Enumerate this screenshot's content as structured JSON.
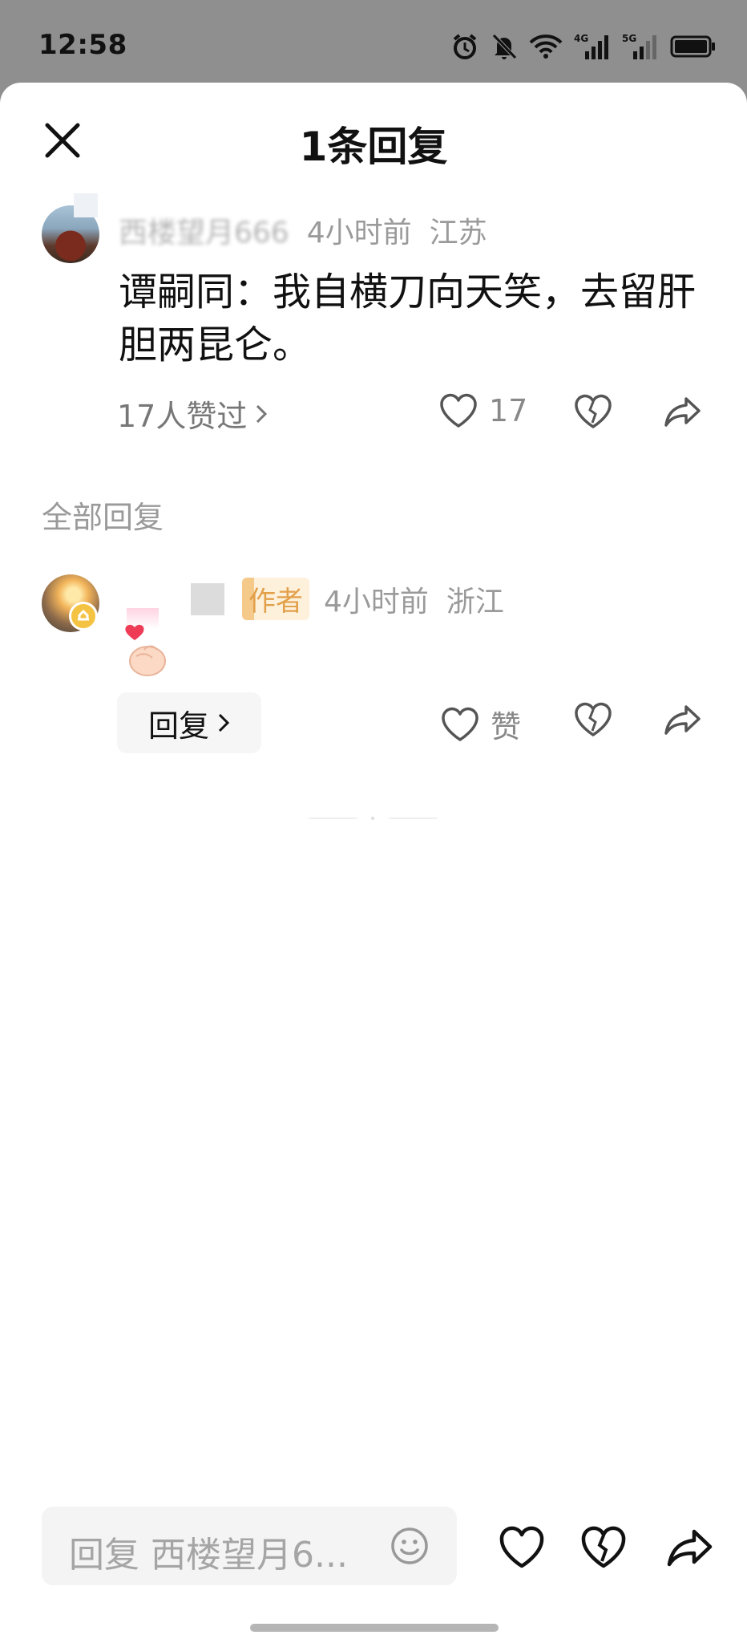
{
  "status_bar": {
    "time": "12:58",
    "icons": [
      "alarm-icon",
      "bell-muted-icon",
      "wifi-icon",
      "signal-4g-icon",
      "signal-5g-icon",
      "battery-icon"
    ],
    "net1": "4G",
    "net2": "5G"
  },
  "sheet": {
    "title": "1条回复",
    "close_icon": "close-icon"
  },
  "main_comment": {
    "username": "西楼望月666",
    "time": "4小时前",
    "location": "江苏",
    "text": "谭嗣同：我自横刀向天笑，去留肝胆两昆仑。",
    "likers_text": "17人赞过",
    "like_count": "17"
  },
  "section": {
    "label": "全部回复"
  },
  "reply": {
    "author_tag": "作者",
    "time": "4小时前",
    "location": "浙江",
    "sticker": "finger-heart-sticker",
    "reply_button": "回复",
    "like_label": "赞"
  },
  "input": {
    "placeholder": "回复 西楼望月6..."
  },
  "colors": {
    "background": "#ffffff",
    "meta_gray": "#9a9a9a",
    "author_tag_text": "#e3a04b",
    "heart_red": "#ee3b56"
  }
}
